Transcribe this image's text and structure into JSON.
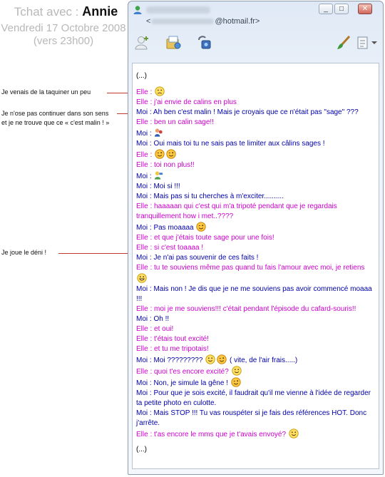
{
  "header": {
    "prefix": "Tchat avec :",
    "name": "Annie",
    "date": "Vendredi 17 Octobre 2008",
    "time": "(vers 23h00)"
  },
  "annotations": [
    {
      "text": "Je venais de la taquiner un peu"
    },
    {
      "text": "Je n'ose pas continuer dans son sens"
    },
    {
      "text": "et je ne trouve que ce « c'est malin ! »"
    },
    {
      "text": "Je joue le déni !"
    }
  ],
  "window": {
    "email_prefix": "<",
    "email_suffix": "@hotmail.fr>",
    "buttons": {
      "minimize": "_",
      "maximize": "□",
      "close": "✕"
    }
  },
  "toolbar": [
    "invite-contact-icon",
    "send-files-icon",
    "webcam-call-icon",
    "brush-icon",
    "more-menu-icon"
  ],
  "colors": {
    "elle": "#cc00cc",
    "moi": "#0000aa"
  },
  "messages": [
    {
      "who": "neutral",
      "text": "(...)"
    },
    {
      "who": "gap",
      "text": ""
    },
    {
      "who": "elle",
      "text": "Elle :",
      "emoji": [
        "sad"
      ]
    },
    {
      "who": "elle",
      "text": "Elle : j'ai envie de calins en plus"
    },
    {
      "who": "moi",
      "text": "Moi : Ah ben c'est malin ! Mais je croyais que ce n'était pas \"sage\" ???"
    },
    {
      "who": "elle",
      "text": "Elle : ben un calin sage!!"
    },
    {
      "who": "moi",
      "text": "Moi :",
      "emoji": [
        "hug"
      ]
    },
    {
      "who": "moi",
      "text": "Moi : Oui mais toi tu ne sais pas te limiter aux câlins sages !"
    },
    {
      "who": "elle",
      "text": "Elle :",
      "emoji": [
        "wink",
        "wink"
      ]
    },
    {
      "who": "elle",
      "text": "Elle : toi non plus!!"
    },
    {
      "who": "moi",
      "text": "Moi :",
      "emoji": [
        "person"
      ]
    },
    {
      "who": "moi",
      "text": "Moi : Moi si !!!"
    },
    {
      "who": "moi",
      "text": "Moi : Mais pas si tu cherches à m'exciter.........."
    },
    {
      "who": "elle",
      "text": "Elle : haaaaan qui c'est qui m'a tripoté pendant que je regardais tranquillement how i met..????"
    },
    {
      "who": "moi",
      "text": "Moi : Pas moaaaa",
      "emoji": [
        "wink"
      ]
    },
    {
      "who": "elle",
      "text": "Elle : et que j'étais toute sage pour une fois!"
    },
    {
      "who": "elle",
      "text": "Elle : si c'est toaaaa !"
    },
    {
      "who": "moi",
      "text": "Moi : Je n'ai pas souvenir de ces faits !"
    },
    {
      "who": "elle",
      "text": "Elle : tu te souviens même pas quand tu fais l'amour avec moi, je retiens",
      "emoji": [
        "grin"
      ]
    },
    {
      "who": "moi",
      "text": "Moi : Mais non ! Je dis que je ne me souviens pas avoir commencé moaaa !!!"
    },
    {
      "who": "elle",
      "text": "Elle : moi je me souviens!!! c'était pendant l'épisode du cafard-souris!!"
    },
    {
      "who": "moi",
      "text": "Moi : Oh !!"
    },
    {
      "who": "elle",
      "text": "Elle : et oui!"
    },
    {
      "who": "elle",
      "text": "Elle : t'étais tout excité!"
    },
    {
      "who": "elle",
      "text": "Elle : et tu me tripotais!"
    },
    {
      "who": "moi",
      "text": "Moi : Moi ?????????",
      "emoji": [
        "smile",
        "wink"
      ],
      "after": "( vite, de l'air frais.....)"
    },
    {
      "who": "elle",
      "text": "Elle : quoi t'es encore excité?",
      "emoji": [
        "smile"
      ]
    },
    {
      "who": "moi",
      "text": "Moi : Non, je simule la gêne !",
      "emoji": [
        "wink"
      ]
    },
    {
      "who": "moi",
      "text": "Moi : Pour que je sois excité, il faudrait qu'il me vienne à l'idée de regarder ta petite photo en culotte."
    },
    {
      "who": "moi",
      "text": "Moi : Mais STOP !!! Tu vas rouspéter si je fais des références HOT. Donc j'arrête."
    },
    {
      "who": "elle",
      "text": "Elle : t'as encore le mms que je t'avais envoyé?",
      "emoji": [
        "smile"
      ]
    },
    {
      "who": "gap",
      "text": ""
    },
    {
      "who": "neutral",
      "text": "(...)"
    }
  ]
}
